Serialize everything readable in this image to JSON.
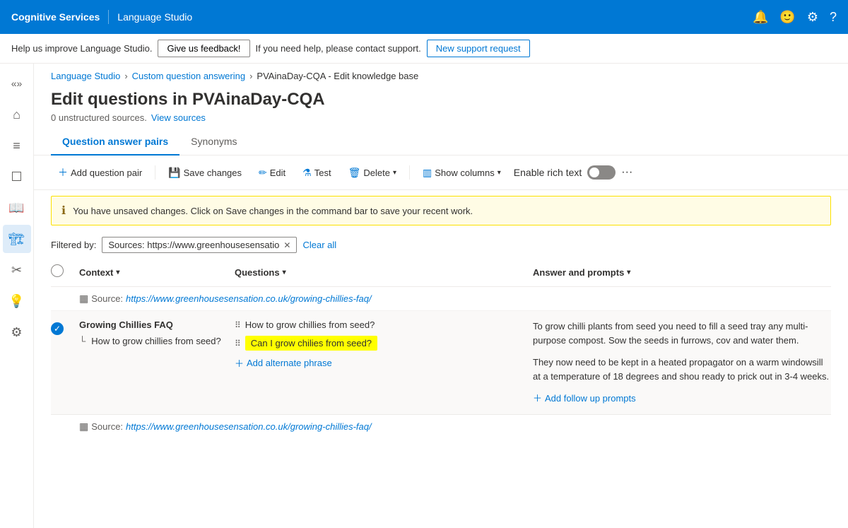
{
  "topnav": {
    "brand": "Cognitive Services",
    "divider": "|",
    "title": "Language Studio",
    "icons": {
      "bell": "🔔",
      "face": "🙂",
      "settings": "⚙",
      "help": "?"
    }
  },
  "feedbackbar": {
    "text": "Help us improve Language Studio.",
    "feedback_btn": "Give us feedback!",
    "support_text": "If you need help, please contact support.",
    "support_btn": "New support request"
  },
  "breadcrumb": {
    "items": [
      "Language Studio",
      "Custom question answering",
      "PVAinaDay-CQA - Edit knowledge base"
    ]
  },
  "page": {
    "title": "Edit questions in PVAinaDay-CQA",
    "subtitle": "0 unstructured sources.",
    "view_sources": "View sources"
  },
  "tabs": [
    {
      "label": "Question answer pairs",
      "active": true
    },
    {
      "label": "Synonyms",
      "active": false
    }
  ],
  "toolbar": {
    "add_pair": "Add question pair",
    "save": "Save changes",
    "edit": "Edit",
    "test": "Test",
    "delete": "Delete",
    "show_columns": "Show columns",
    "enable_rich_text": "Enable rich text",
    "more": "···"
  },
  "warning": {
    "text": "You have unsaved changes. Click on Save changes in the command bar to save your recent work."
  },
  "filter": {
    "label": "Filtered by:",
    "chip": "Sources: https://www.greenhousesensatio",
    "clear": "Clear all"
  },
  "table": {
    "columns": [
      "",
      "Context",
      "Questions",
      "Answer and prompts"
    ]
  },
  "source_row": {
    "icon": "▦",
    "label": "Source:",
    "url": "https://www.greenhousesensation.co.uk/growing-chillies-faq/"
  },
  "qa_row": {
    "title": "Growing Chillies FAQ",
    "subtitle": "How to grow chillies from seed?",
    "questions": [
      "How to grow chillies from seed?"
    ],
    "highlighted_question": "Can I grow chilies from seed?",
    "add_phrase": "Add alternate phrase",
    "answer_paragraphs": [
      "To grow chilli plants from seed you need to fill a seed tray any multi-purpose compost. Sow the seeds in furrows, cov and water them.",
      "They now need to be kept in a heated propagator  on a warm windowsill at a temperature of 18 degrees and shou ready to prick out in 3-4 weeks."
    ],
    "add_followup": "Add follow up prompts"
  },
  "bottom_source": {
    "icon": "▦",
    "label": "Source:",
    "url": "https://www.greenhousesensation.co.uk/growing-chillies-faq/"
  },
  "sidebar_icons": [
    "«",
    "⌂",
    "≡",
    "☐",
    "📘",
    "🏗",
    "✂",
    "💡",
    "⚙"
  ]
}
